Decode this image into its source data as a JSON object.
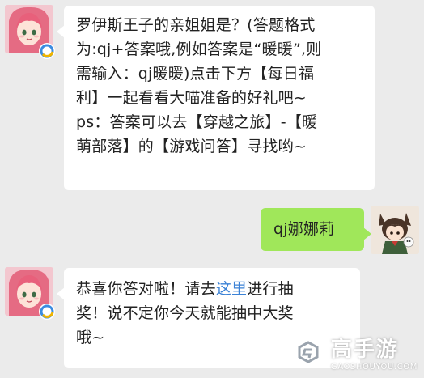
{
  "messages": [
    {
      "side": "left",
      "avatar": "anime-girl-pink-hair",
      "lines": [
        "罗伊斯王子的亲姐姐是？(答题格式",
        "为:qj+答案哦,例如答案是“暖暖”,则",
        "需输入：qj暖暖)点击下方【每日福",
        "利】一起看看大喵准备的好礼吧~",
        "ps：答案可以去【穿越之旅】-【暖",
        "萌部落】的【游戏问答】寻找哟~"
      ]
    },
    {
      "side": "right",
      "avatar": "chibi-cat-ear-boy",
      "text": "qj娜娜莉"
    },
    {
      "side": "left",
      "avatar": "anime-girl-pink-hair",
      "line1_before": "恭喜你答对啦！请去",
      "line1_link": "这里",
      "line1_after": "进行抽",
      "line2": "奖！说不定你今天就能抽中大奖",
      "line3": "哦~"
    }
  ],
  "watermark": {
    "name": "高手游",
    "sub": "GAOSHOUYOU.COM",
    "icon": "gaoshouyou-logo-icon"
  },
  "colors": {
    "background": "#ebebeb",
    "bubble_left": "#ffffff",
    "bubble_right": "#a0e75a",
    "link": "#3b82d6"
  }
}
